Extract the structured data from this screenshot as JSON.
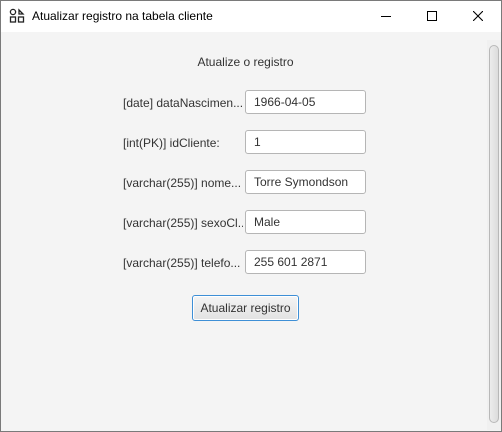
{
  "window": {
    "title": "Atualizar registro na tabela cliente",
    "app_icon": "app-icon",
    "controls": {
      "minimize_icon": "minimize-icon",
      "maximize_icon": "maximize-icon",
      "close_icon": "close-icon"
    }
  },
  "form": {
    "heading": "Atualize o registro",
    "fields": [
      {
        "label": "[date] dataNascimen...",
        "value": "1966-04-05"
      },
      {
        "label": "[int(PK)] idCliente:",
        "value": "1"
      },
      {
        "label": "[varchar(255)] nome...",
        "value": "Torre Symondson"
      },
      {
        "label": "[varchar(255)] sexoCl...",
        "value": "Male"
      },
      {
        "label": "[varchar(255)] telefo...",
        "value": "255 601 2871"
      }
    ],
    "submit_label": "Atualizar registro"
  },
  "scrollbar": {
    "visible": true
  }
}
